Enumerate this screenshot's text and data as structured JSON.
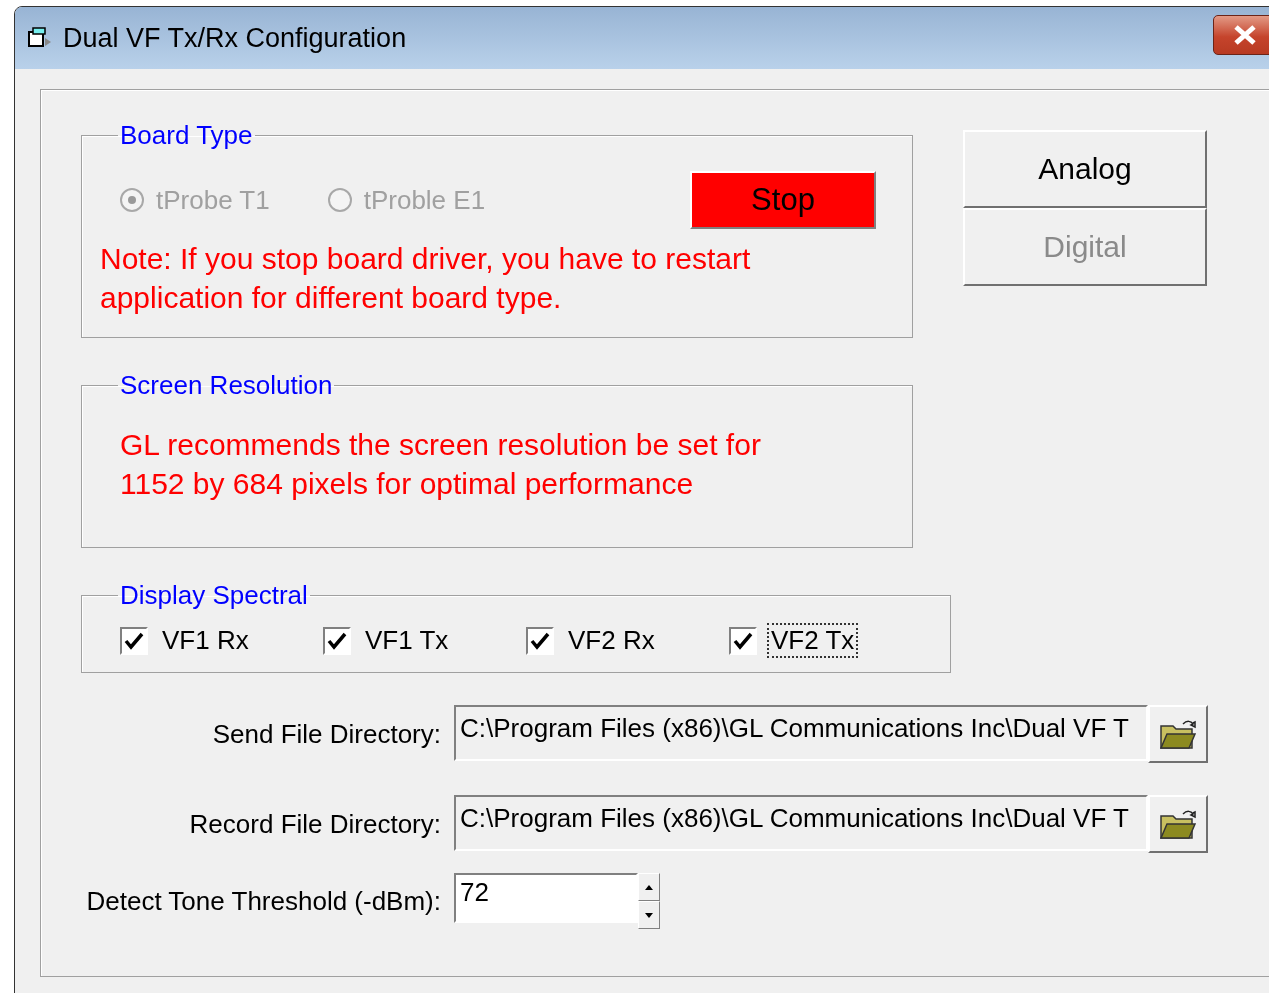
{
  "window": {
    "title": "Dual VF Tx/Rx Configuration"
  },
  "board_type": {
    "legend": "Board Type",
    "radios": [
      {
        "label": "tProbe T1",
        "selected": true,
        "disabled": true
      },
      {
        "label": "tProble E1",
        "selected": false,
        "disabled": true
      }
    ],
    "stop_button": "Stop",
    "note": "Note: If you stop board driver, you have to restart application for different board type."
  },
  "screen_resolution": {
    "legend": "Screen Resolution",
    "message": "GL recommends the screen resolution be set for 1152 by 684 pixels for optimal performance"
  },
  "display_spectral": {
    "legend": "Display Spectral",
    "checkboxes": [
      {
        "label": "VF1 Rx",
        "checked": true,
        "focused": false
      },
      {
        "label": "VF1 Tx",
        "checked": true,
        "focused": false
      },
      {
        "label": "VF2 Rx",
        "checked": true,
        "focused": false
      },
      {
        "label": "VF2 Tx",
        "checked": true,
        "focused": true
      }
    ]
  },
  "mode_buttons": [
    {
      "label": "Analog",
      "disabled": false
    },
    {
      "label": "Digital",
      "disabled": true
    }
  ],
  "directories": [
    {
      "label": "Send File Directory:",
      "value": "C:\\Program Files (x86)\\GL Communications Inc\\Dual VF T"
    },
    {
      "label": "Record File Directory:",
      "value": "C:\\Program Files (x86)\\GL Communications Inc\\Dual VF T"
    }
  ],
  "threshold": {
    "label": "Detect Tone Threshold (-dBm):",
    "value": "72"
  }
}
